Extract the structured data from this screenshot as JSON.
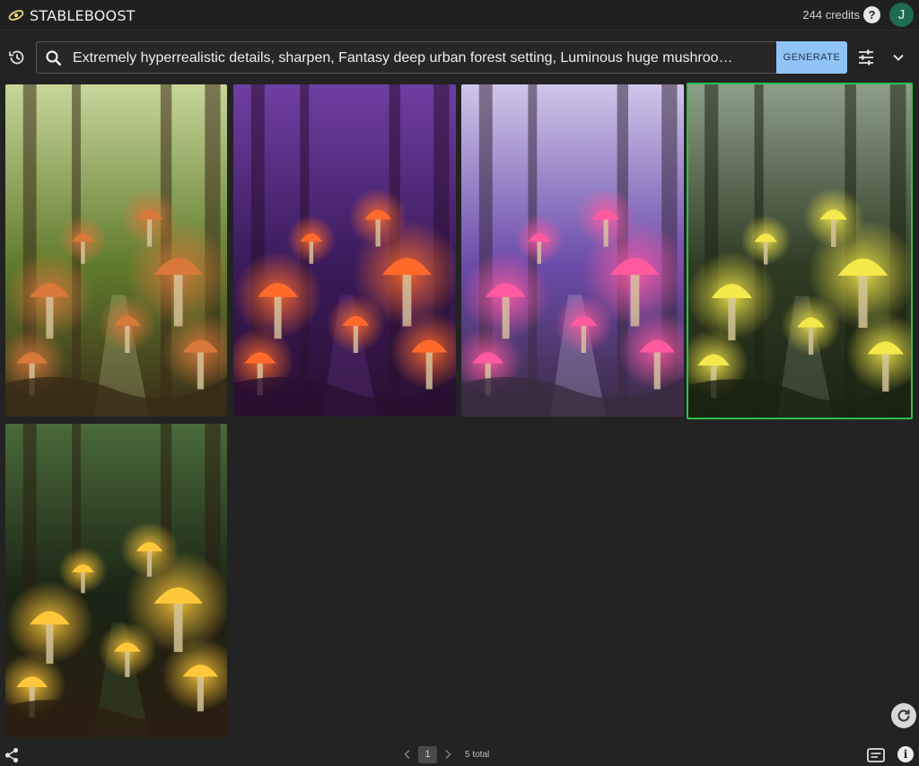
{
  "header": {
    "brand": "STABLEBOOST",
    "credits": "244 credits",
    "help_icon": "question-circle-icon",
    "avatar_initial": "J"
  },
  "search": {
    "prompt": "Extremely hyperrealistic details, sharpen, Fantasy deep urban forest setting, Luminous huge mushroo…",
    "generate_label": "GENERATE"
  },
  "gallery": {
    "selected_index": 3,
    "images": [
      {
        "icon": "image-thumbnail",
        "palette": [
          "#c8d69a",
          "#5f7a2c",
          "#3a2a18",
          "#d8783a"
        ]
      },
      {
        "icon": "image-thumbnail",
        "palette": [
          "#6e3fa3",
          "#3a1a5a",
          "#2a1030",
          "#ff6a2a"
        ]
      },
      {
        "icon": "image-thumbnail",
        "palette": [
          "#cfc6ea",
          "#6a4aa8",
          "#3a2a40",
          "#ff5aa0"
        ]
      },
      {
        "icon": "image-thumbnail",
        "palette": [
          "#8ea08a",
          "#2f3b22",
          "#1b2212",
          "#f4e84a"
        ]
      },
      {
        "icon": "image-thumbnail",
        "palette": [
          "#4a6a3a",
          "#1a2414",
          "#2a1e10",
          "#ffc83a"
        ]
      }
    ]
  },
  "pagination": {
    "current_page": "1",
    "total_label": "5 total"
  },
  "colors": {
    "background": "#232323",
    "generate_button": "#90c4f7",
    "selected_outline": "#27c34a",
    "avatar": "#1f6b4f"
  }
}
